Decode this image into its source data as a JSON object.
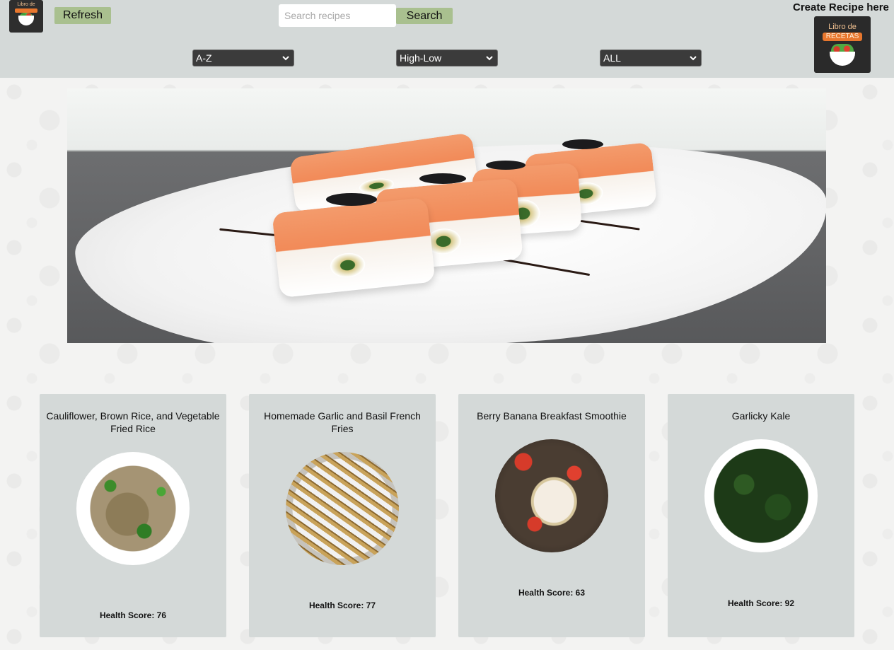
{
  "header": {
    "refresh_label": "Refresh",
    "search": {
      "placeholder": "Search recipes",
      "value": ""
    },
    "search_label": "Search",
    "filters": {
      "alphabetical": "A-Z",
      "health_score": "High-Low",
      "diet": "ALL"
    },
    "create_label": "Create Recipe here",
    "logo_text": "Libro de",
    "logo_band": "RECETAS"
  },
  "hero": {
    "image": "sushi-rolls-plate"
  },
  "recipes": [
    {
      "title": "Cauliflower, Brown Rice, and Vegetable Fried Rice",
      "health_label": "Health Score:",
      "health_score": 76
    },
    {
      "title": "Homemade Garlic and Basil French Fries",
      "health_label": "Health Score:",
      "health_score": 77
    },
    {
      "title": "Berry Banana Breakfast Smoothie",
      "health_label": "Health Score:",
      "health_score": 63
    },
    {
      "title": "Garlicky Kale",
      "health_label": "Health Score:",
      "health_score": 92
    }
  ],
  "colors": {
    "header_bg": "#d4d9d8",
    "button_bg": "#a9c08f",
    "card_bg": "#d4d9d8",
    "select_bg": "#3b3b3b"
  }
}
